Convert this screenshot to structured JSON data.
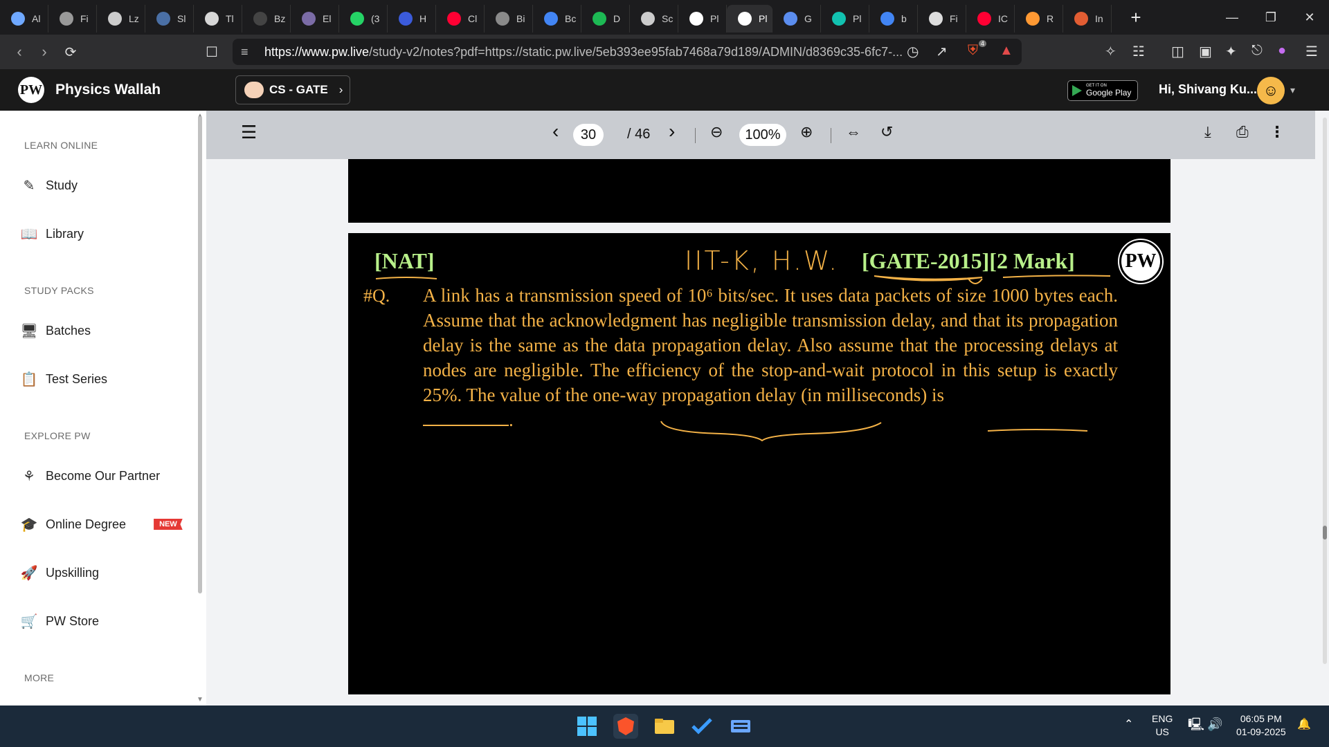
{
  "tabs": [
    {
      "label": "Al",
      "color": "#6fa8ff"
    },
    {
      "label": "Fi",
      "color": "#999999"
    },
    {
      "label": "Lz",
      "color": "#cccccc"
    },
    {
      "label": "Sl",
      "color": "#4a6fa5"
    },
    {
      "label": "Tl",
      "color": "#d7d7d7"
    },
    {
      "label": "Bz",
      "color": "#444444"
    },
    {
      "label": "El",
      "color": "#7b6ca6"
    },
    {
      "label": "(3",
      "color": "#25d366"
    },
    {
      "label": "H",
      "color": "#3b5bdb"
    },
    {
      "label": "Cl",
      "color": "#ff0033"
    },
    {
      "label": "Bi",
      "color": "#8a8a8a"
    },
    {
      "label": "Bc",
      "color": "#4285f4"
    },
    {
      "label": "D",
      "color": "#1db954"
    },
    {
      "label": "Sc",
      "color": "#cccccc"
    },
    {
      "label": "Pl",
      "color": "#ffffff"
    },
    {
      "label": "Pl",
      "color": "#ffffff",
      "active": true
    },
    {
      "label": "G",
      "color": "#5b8def"
    },
    {
      "label": "Pl",
      "color": "#12c2b0"
    },
    {
      "label": "b",
      "color": "#4285f4"
    },
    {
      "label": "Fi",
      "color": "#dddddd"
    },
    {
      "label": "IC",
      "color": "#ff0033"
    },
    {
      "label": "R",
      "color": "#ff9933"
    },
    {
      "label": "In",
      "color": "#e25d33"
    }
  ],
  "address": {
    "url_host": "https://www.pw.live",
    "url_rest": "/study-v2/notes?pdf=https://static.pw.live/5eb393ee95fab7468a79d189/ADMIN/d8369c35-6fc7-...",
    "brave_badge": "4"
  },
  "header": {
    "logo_text": "PW",
    "brand": "Physics Wallah",
    "batch": "CS - GATE",
    "gplay_small": "GET IT ON",
    "gplay": "Google Play",
    "greeting": "Hi, Shivang Ku..."
  },
  "sidebar": {
    "sections": [
      "LEARN ONLINE",
      "STUDY PACKS",
      "EXPLORE PW",
      "MORE"
    ],
    "items": [
      {
        "label": "Study"
      },
      {
        "label": "Library"
      },
      {
        "label": "Batches"
      },
      {
        "label": "Test Series"
      },
      {
        "label": "Become Our Partner"
      },
      {
        "label": "Online Degree"
      },
      {
        "label": "Upskilling"
      },
      {
        "label": "PW Store"
      }
    ],
    "new_badge": "NEW"
  },
  "viewer": {
    "page_current": "30",
    "page_total": "/ 46",
    "zoom": "100%"
  },
  "pdf": {
    "tag": "[NAT]",
    "handwritten": "IIT-K, H.W.",
    "exam": "[GATE-2015][2 Mark]",
    "question_no": "#Q.",
    "question": "A link has a transmission speed of 10⁶ bits/sec. It uses data packets of size 1000 bytes each. Assume that the acknowledgment has negligible transmission delay, and that its propagation delay is the same as the data propagation delay. Also assume that the processing delays at nodes are negligible. The efficiency of the stop-and-wait protocol in this setup is exactly 25%. The value of the one-way propagation delay (in milliseconds) is",
    "question_end": "."
  },
  "taskbar": {
    "lang_top": "ENG",
    "lang_bottom": "US",
    "time": "06:05 PM",
    "date": "01-09-2025"
  }
}
